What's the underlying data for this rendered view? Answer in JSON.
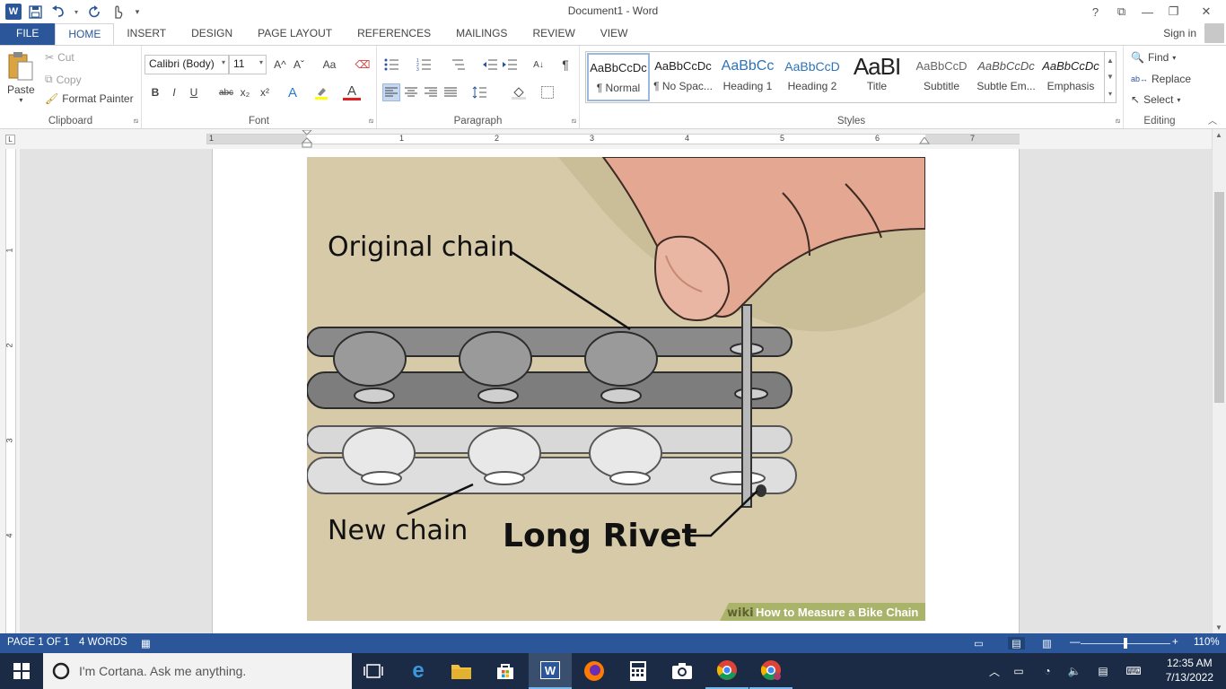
{
  "window": {
    "title": "Document1 - Word",
    "help": "?",
    "restore": "⧉",
    "minimize": "—",
    "maximize": "❐",
    "close": "✕"
  },
  "qat": {
    "customize": "▾"
  },
  "tabs": [
    {
      "label": "FILE"
    },
    {
      "label": "HOME"
    },
    {
      "label": "INSERT"
    },
    {
      "label": "DESIGN"
    },
    {
      "label": "PAGE LAYOUT"
    },
    {
      "label": "REFERENCES"
    },
    {
      "label": "MAILINGS"
    },
    {
      "label": "REVIEW"
    },
    {
      "label": "VIEW"
    }
  ],
  "signin": "Sign in",
  "clipboard": {
    "paste": "Paste",
    "cut": "Cut",
    "copy": "Copy",
    "format_painter": "Format Painter",
    "label": "Clipboard"
  },
  "font": {
    "name": "Calibri (Body)",
    "size": "11",
    "label": "Font",
    "bold": "B",
    "italic": "I",
    "underline": "U",
    "strike": "abc",
    "sub": "x₂",
    "sup": "x²",
    "grow": "A^",
    "shrink": "Aˇ",
    "case": "Aa",
    "effects": "A",
    "color": "A"
  },
  "paragraph": {
    "label": "Paragraph",
    "pilcrow": "¶",
    "sort": "A↓"
  },
  "styles": {
    "label": "Styles",
    "items": [
      {
        "preview": "AaBbCcDc",
        "name": "¶ Normal"
      },
      {
        "preview": "AaBbCcDc",
        "name": "¶ No Spac..."
      },
      {
        "preview": "AaBbCc",
        "name": "Heading 1"
      },
      {
        "preview": "AaBbCcD",
        "name": "Heading 2"
      },
      {
        "preview": "AaBI",
        "name": "Title"
      },
      {
        "preview": "AaBbCcD",
        "name": "Subtitle"
      },
      {
        "preview": "AaBbCcDc",
        "name": "Subtle Em..."
      },
      {
        "preview": "AaBbCcDc",
        "name": "Emphasis"
      }
    ]
  },
  "editing": {
    "find": "Find",
    "replace": "Replace",
    "select": "Select",
    "label": "Editing"
  },
  "ruler": {
    "h_numbers": [
      "1",
      "1",
      "2",
      "3",
      "4",
      "5",
      "6",
      "7"
    ],
    "v_numbers": [
      "1",
      "2",
      "3",
      "4"
    ]
  },
  "image": {
    "label_original": "Original chain",
    "label_new": "New chain",
    "label_rivet": "Long Rivet",
    "watermark_brand": "wiki",
    "watermark_text": "How to Measure a Bike Chain"
  },
  "status": {
    "page": "PAGE 1 OF 1",
    "words": "4 WORDS",
    "zoom": "110%"
  },
  "taskbar": {
    "cortana": "I'm Cortana. Ask me anything.",
    "time": "12:35 AM",
    "date": "7/13/2022"
  }
}
